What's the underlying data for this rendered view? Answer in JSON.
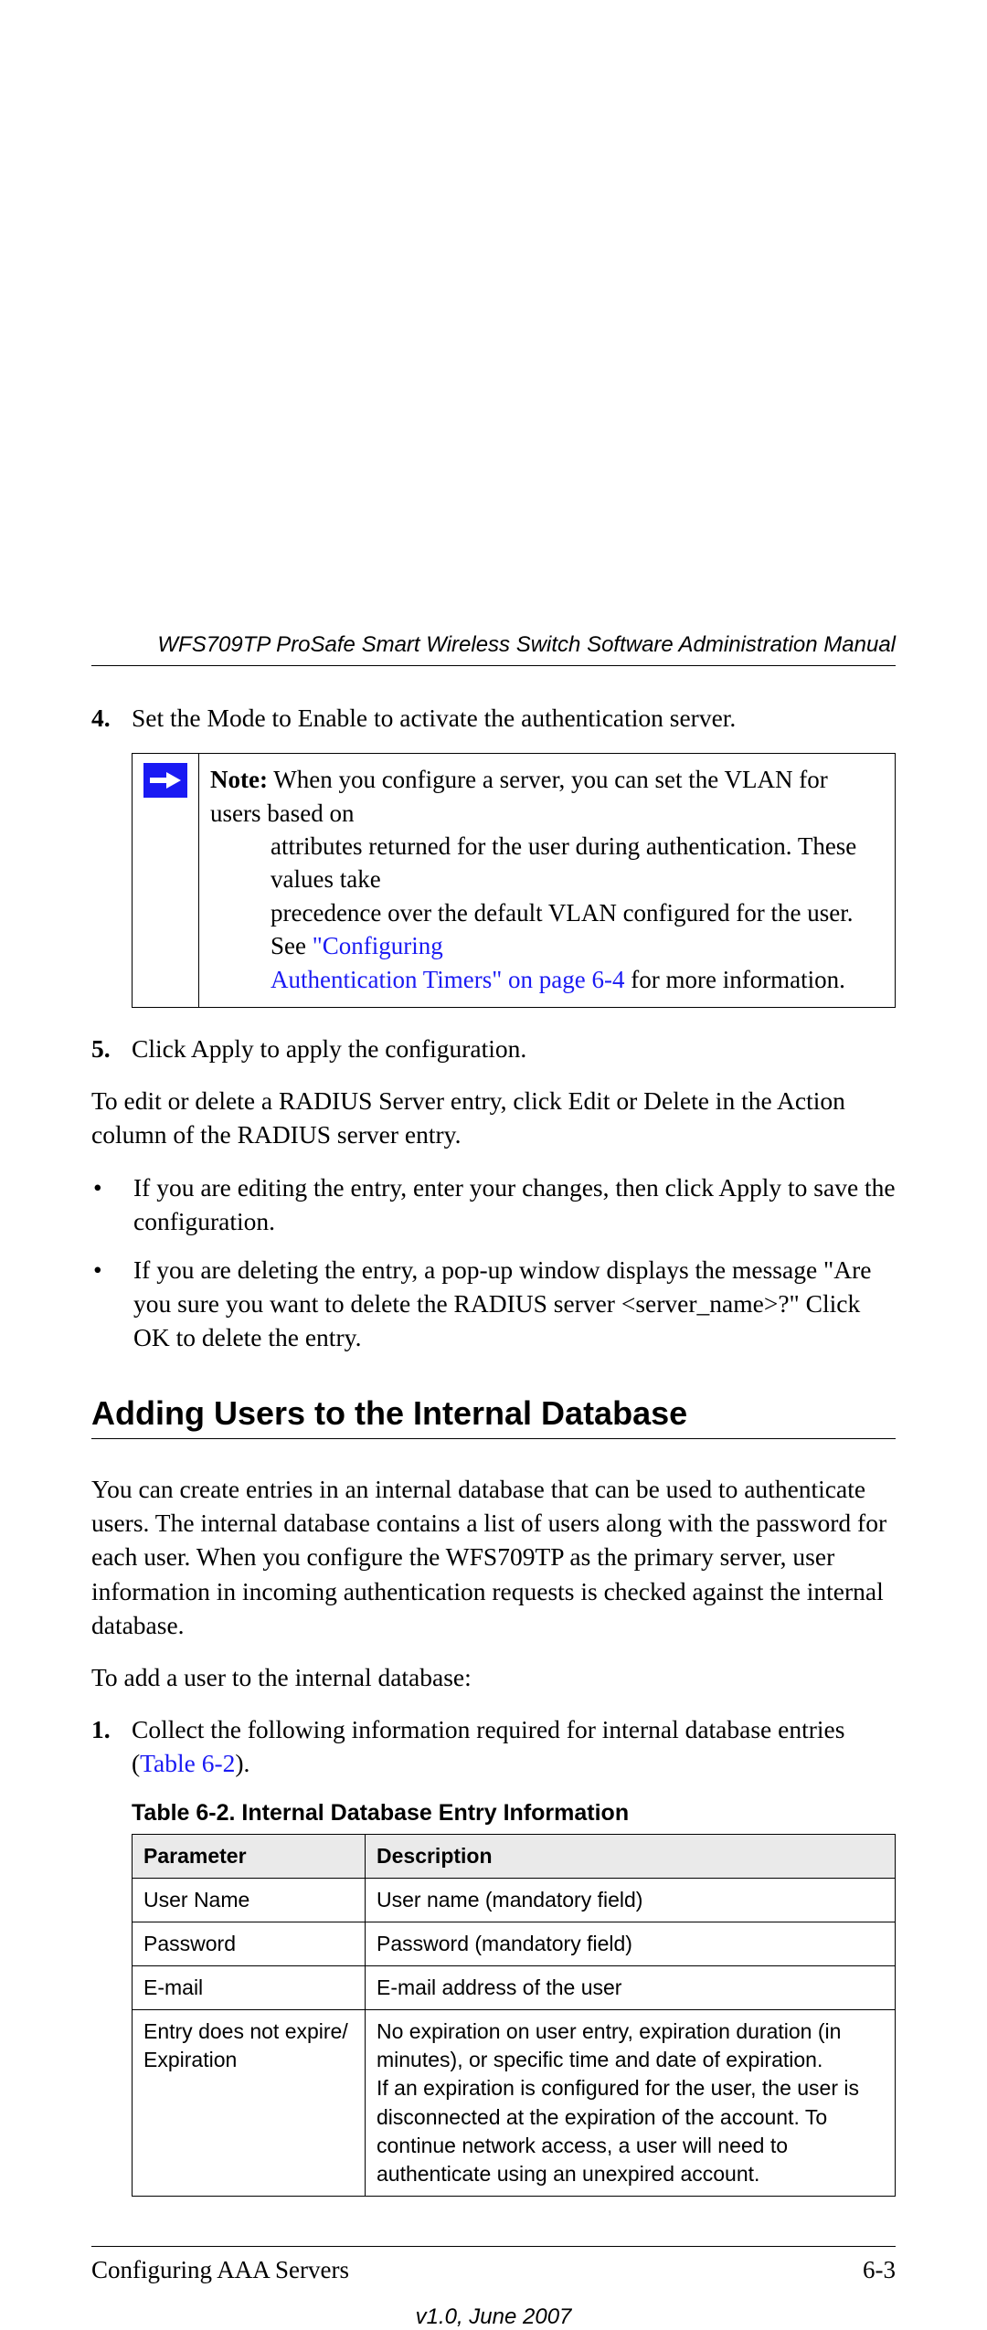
{
  "header": {
    "title": "WFS709TP ProSafe Smart Wireless Switch Software Administration Manual"
  },
  "step4": {
    "num": "4.",
    "text": "Set the Mode to Enable to activate the authentication server."
  },
  "note": {
    "label": "Note:",
    "line1_after_label": " When you configure a server, you can set the VLAN for users based on",
    "line2": "attributes returned for the user during authentication. These values take",
    "line3_a": "precedence over the default VLAN configured for the user. See ",
    "line3_link": "\"Configuring",
    "line4_link": "Authentication Timers\" on page 6-4",
    "line4_b": " for more information."
  },
  "step5": {
    "num": "5.",
    "text": "Click Apply to apply the configuration."
  },
  "para_edit": "To edit or delete a RADIUS Server entry, click Edit or Delete in the Action column of the RADIUS server entry.",
  "ul1": "If you are editing the entry, enter your changes, then click Apply to save the configuration.",
  "ul2": "If you are deleting the entry, a pop-up window displays the message \"Are you sure you want to delete the RADIUS server <server_name>?\" Click OK to delete the entry.",
  "h2": "Adding Users to the Internal Database",
  "para_intro": "You can create entries in an internal database that can be used to authenticate users. The internal database contains a list of users along with the password for each user. When you configure the WFS709TP as the primary server, user information in incoming authentication requests is checked against the internal database.",
  "para_toadd": "To add a user to the internal database:",
  "step1": {
    "num": "1.",
    "text_a": "Collect the following information required for internal database entries (",
    "link": "Table 6-2",
    "text_b": ")."
  },
  "table": {
    "caption": "Table 6-2. Internal Database Entry Information",
    "h_param": "Parameter",
    "h_desc": "Description",
    "rows": [
      {
        "param": "User Name",
        "desc": "User name (mandatory field)"
      },
      {
        "param": "Password",
        "desc": "Password (mandatory field)"
      },
      {
        "param": "E-mail",
        "desc": "E-mail address of the user"
      },
      {
        "param": "Entry does not expire/\nExpiration",
        "desc": "No expiration on user entry, expiration duration (in minutes), or specific time and date of expiration.\nIf an expiration is configured for the user, the user is disconnected at the expiration of the account. To continue network access, a user will need to authenticate using an unexpired account."
      }
    ]
  },
  "footer": {
    "left": "Configuring AAA Servers",
    "right": "6-3",
    "version": "v1.0, June 2007"
  }
}
